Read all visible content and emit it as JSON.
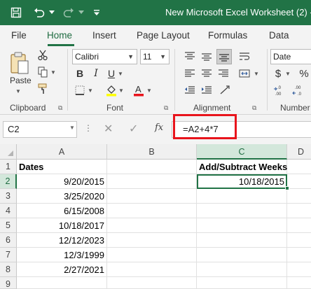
{
  "window": {
    "title": "New Microsoft Excel Worksheet (2) -",
    "save_icon": "save-icon",
    "undo_icon": "undo-icon",
    "redo_icon": "redo-icon",
    "accent": "#217346"
  },
  "tabs": [
    "File",
    "Home",
    "Insert",
    "Page Layout",
    "Formulas",
    "Data"
  ],
  "ribbon": {
    "clipboard": {
      "paste_label": "Paste",
      "group_label": "Clipboard"
    },
    "font": {
      "font_name": "Calibri",
      "font_size": "11",
      "group_label": "Font",
      "bold_label": "B",
      "italic_label": "I",
      "underline_label": "U",
      "font_color": "#e8141c",
      "fill_color": "#ffff00"
    },
    "alignment": {
      "group_label": "Alignment"
    },
    "number": {
      "format": "Date",
      "group_label": "Number",
      "currency_symbol": "$"
    }
  },
  "formula_bar": {
    "name_box": "C2",
    "fx_label": "fx",
    "formula": "=A2+4*7",
    "highlight_color": "#e8141c"
  },
  "sheet": {
    "columns": [
      "A",
      "B",
      "C",
      "D"
    ],
    "rows": [
      "1",
      "2",
      "3",
      "4",
      "5",
      "6",
      "7",
      "8",
      "9"
    ],
    "cells": {
      "A1": "Dates",
      "A2": "9/20/2015",
      "A3": "3/25/2020",
      "A4": "6/15/2008",
      "A5": "10/18/2017",
      "A6": "12/12/2023",
      "A7": "12/3/1999",
      "A8": "2/27/2021",
      "C1": "Add/Subtract Weeks",
      "C2": "10/18/2015"
    },
    "active_cell": "C2"
  }
}
